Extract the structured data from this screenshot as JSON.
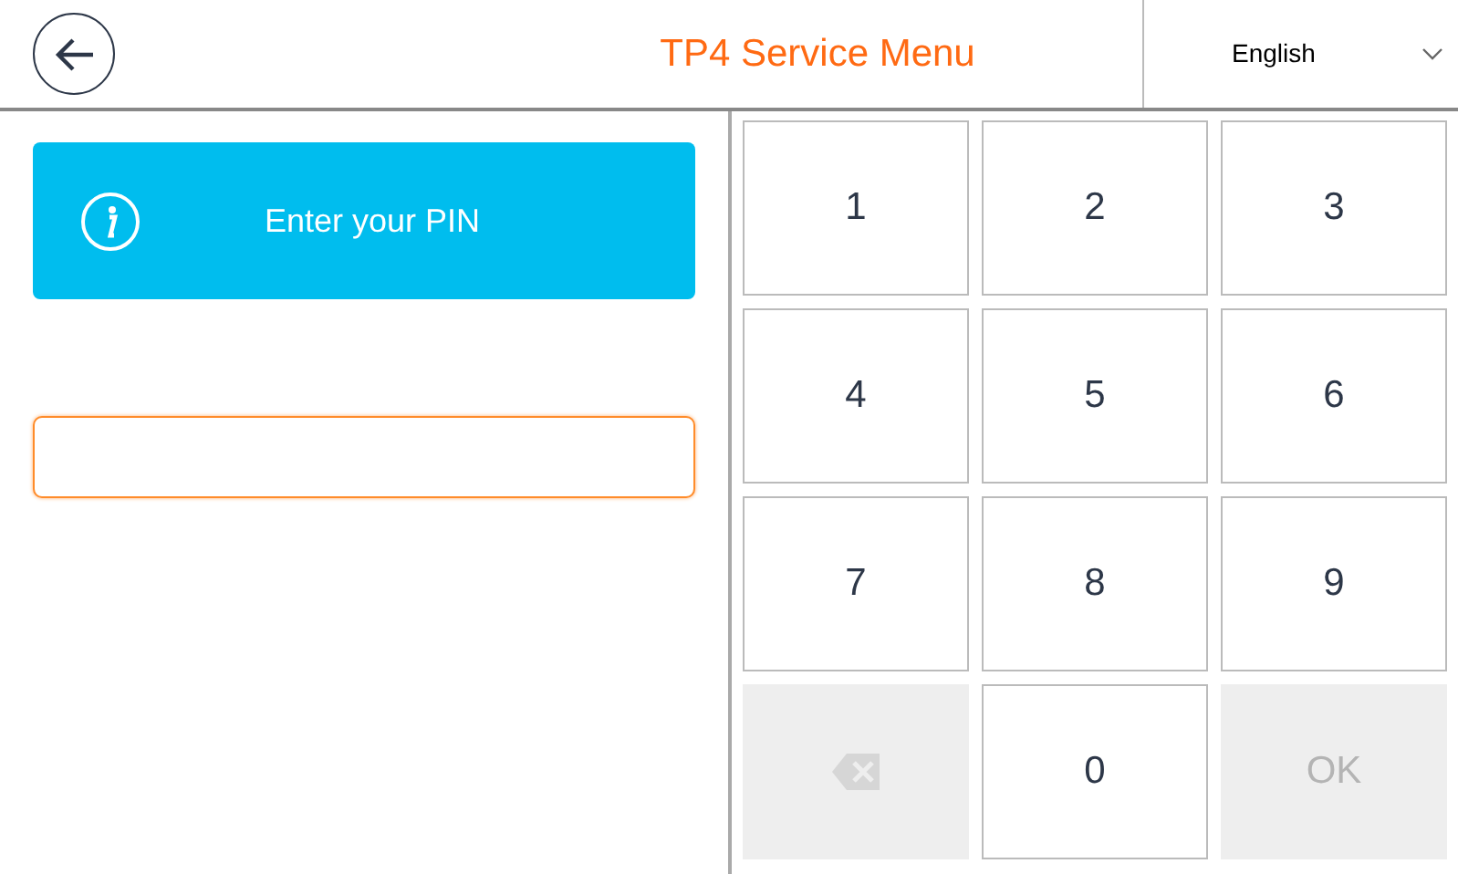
{
  "header": {
    "title": "TP4 Service Menu",
    "language": "English"
  },
  "info_banner": {
    "text": "Enter your PIN"
  },
  "pin_field": {
    "focused": true
  },
  "keypad": [
    {
      "kind": "digit",
      "label": "1",
      "disabled": false
    },
    {
      "kind": "digit",
      "label": "2",
      "disabled": false
    },
    {
      "kind": "digit",
      "label": "3",
      "disabled": false
    },
    {
      "kind": "digit",
      "label": "4",
      "disabled": false
    },
    {
      "kind": "digit",
      "label": "5",
      "disabled": false
    },
    {
      "kind": "digit",
      "label": "6",
      "disabled": false
    },
    {
      "kind": "digit",
      "label": "7",
      "disabled": false
    },
    {
      "kind": "digit",
      "label": "8",
      "disabled": false
    },
    {
      "kind": "digit",
      "label": "9",
      "disabled": false
    },
    {
      "kind": "backspace",
      "disabled": true
    },
    {
      "kind": "digit",
      "label": "0",
      "disabled": false
    },
    {
      "kind": "ok",
      "label": "OK",
      "disabled": true
    }
  ]
}
